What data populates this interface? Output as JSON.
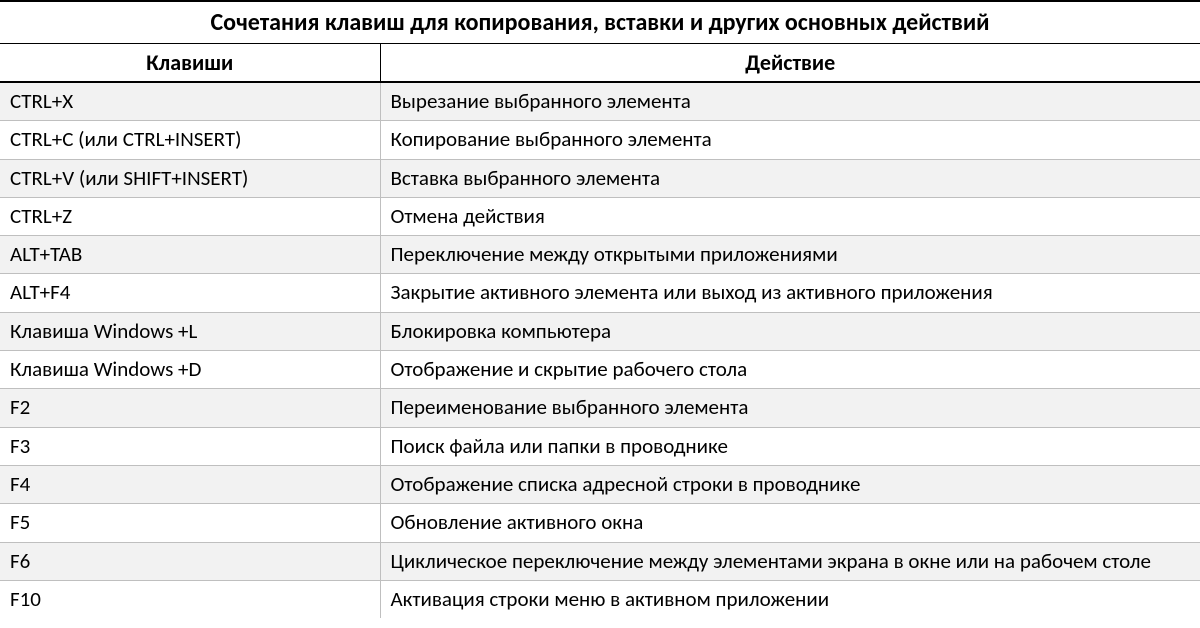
{
  "title": "Сочетания клавиш для копирования, вставки и других основных действий",
  "columns": {
    "keys": "Клавиши",
    "action": "Действие"
  },
  "rows": [
    {
      "keys": "CTRL+X",
      "action": "Вырезание выбранного элемента"
    },
    {
      "keys": "CTRL+C (или CTRL+INSERT)",
      "action": "Копирование выбранного элемента"
    },
    {
      "keys": "CTRL+V (или SHIFT+INSERT)",
      "action": "Вставка выбранного элемента"
    },
    {
      "keys": "CTRL+Z",
      "action": "Отмена действия"
    },
    {
      "keys": "ALT+TAB",
      "action": "Переключение между открытыми приложениями"
    },
    {
      "keys": "ALT+F4",
      "action": "Закрытие активного элемента или выход из активного приложения"
    },
    {
      "keys": "Клавиша Windows  +L",
      "action": "Блокировка компьютера"
    },
    {
      "keys": "Клавиша Windows  +D",
      "action": "Отображение и скрытие рабочего стола"
    },
    {
      "keys": "F2",
      "action": "Переименование выбранного элемента"
    },
    {
      "keys": "F3",
      "action": "Поиск файла или папки в проводнике"
    },
    {
      "keys": "F4",
      "action": "Отображение списка адресной строки в проводнике"
    },
    {
      "keys": "F5",
      "action": "Обновление активного окна"
    },
    {
      "keys": "F6",
      "action": "Циклическое переключение между элементами экрана в окне или на рабочем столе"
    },
    {
      "keys": "F10",
      "action": "Активация строки меню в активном приложении"
    }
  ]
}
